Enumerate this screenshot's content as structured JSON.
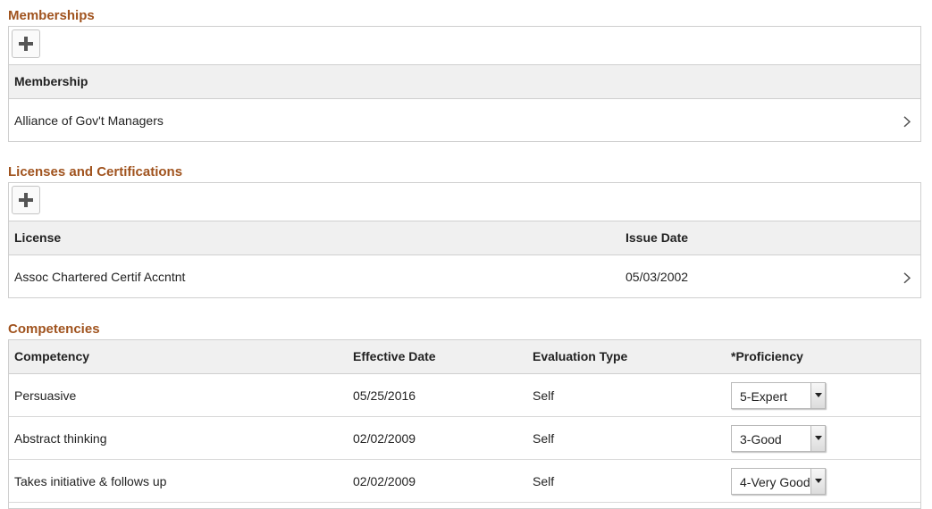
{
  "memberships": {
    "title": "Memberships",
    "add_icon": "plus-icon",
    "column_header": "Membership",
    "rows": [
      {
        "membership": "Alliance of Gov't Managers"
      }
    ]
  },
  "licenses": {
    "title": "Licenses and Certifications",
    "add_icon": "plus-icon",
    "columns": {
      "license": "License",
      "issue_date": "Issue Date"
    },
    "rows": [
      {
        "license": "Assoc Chartered Certif Accntnt",
        "issue_date": "05/03/2002"
      }
    ]
  },
  "competencies": {
    "title": "Competencies",
    "columns": {
      "competency": "Competency",
      "effective_date": "Effective Date",
      "evaluation_type": "Evaluation Type",
      "proficiency": "*Proficiency"
    },
    "rows": [
      {
        "competency": "Persuasive",
        "effective_date": "05/25/2016",
        "evaluation_type": "Self",
        "proficiency": "5-Expert"
      },
      {
        "competency": "Abstract thinking",
        "effective_date": "02/02/2009",
        "evaluation_type": "Self",
        "proficiency": "3-Good"
      },
      {
        "competency": "Takes initiative & follows up",
        "effective_date": "02/02/2009",
        "evaluation_type": "Self",
        "proficiency": "4-Very Good"
      }
    ]
  },
  "colors": {
    "section_title": "#a0531e",
    "header_bg": "#f0f0f0",
    "border": "#cfcfcf"
  }
}
